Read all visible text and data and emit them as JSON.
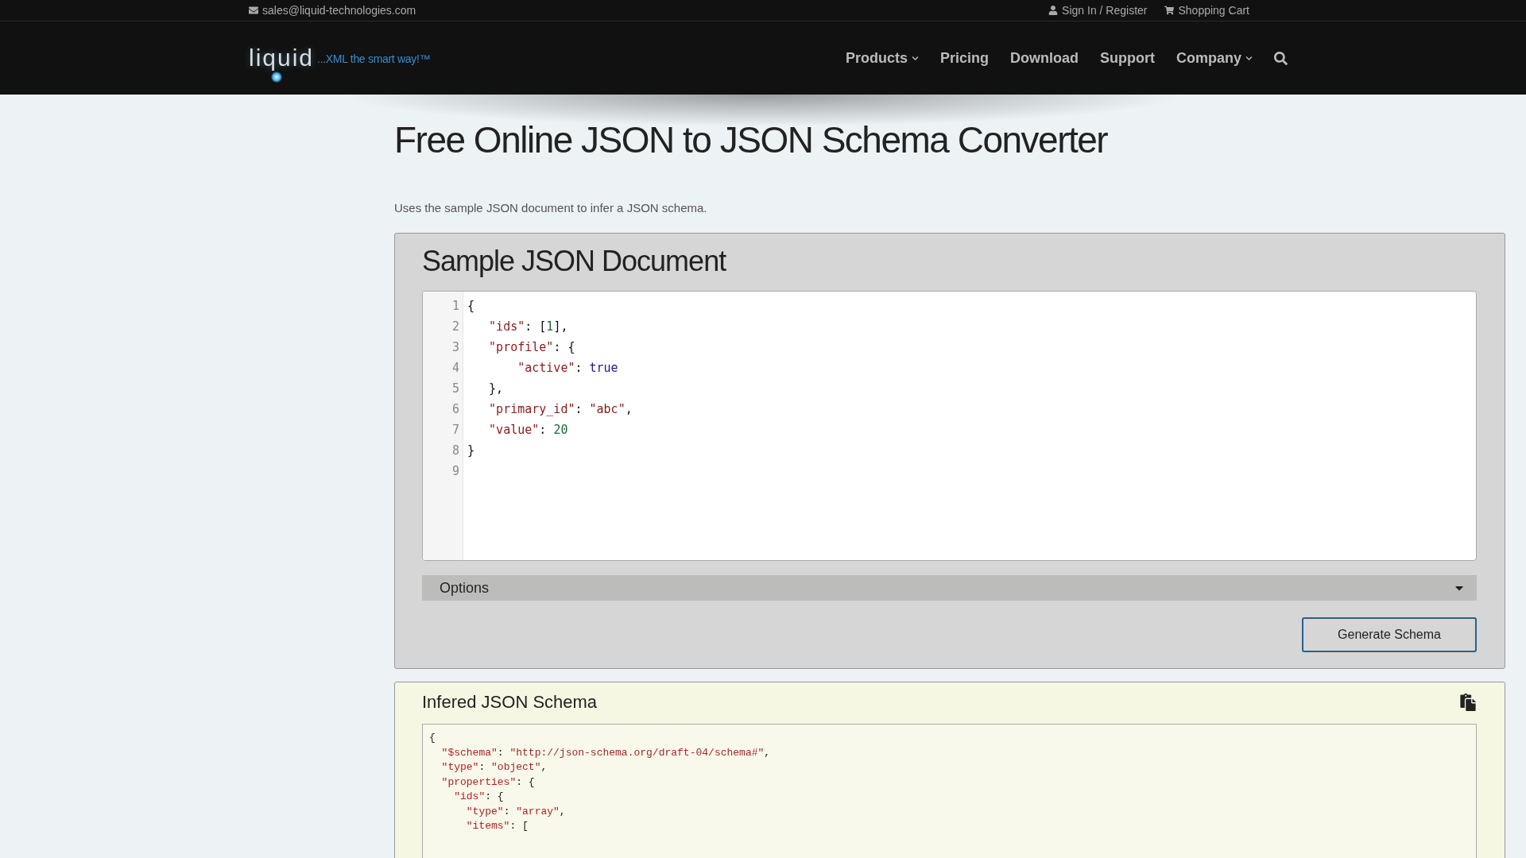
{
  "top_bar": {
    "email": "sales@liquid-technologies.com",
    "sign_in": "Sign In / Register",
    "cart": "Shopping Cart"
  },
  "logo": {
    "name": "liquid",
    "tagline": "...XML the smart way!™"
  },
  "nav": [
    {
      "label": "Products",
      "dropdown": true
    },
    {
      "label": "Pricing",
      "dropdown": false
    },
    {
      "label": "Download",
      "dropdown": false
    },
    {
      "label": "Support",
      "dropdown": false
    },
    {
      "label": "Company",
      "dropdown": true
    }
  ],
  "page": {
    "title": "Free Online JSON to JSON Schema Converter",
    "intro": "Uses the sample JSON document to infer a JSON schema."
  },
  "sample_panel": {
    "heading": "Sample JSON Document",
    "lines": [
      {
        "number": "1",
        "tokens": [
          {
            "kind": "punct",
            "text": "{"
          }
        ]
      },
      {
        "number": "2",
        "tokens": [
          {
            "kind": "key",
            "text": "   \"ids\""
          },
          {
            "kind": "punct",
            "text": ": ["
          },
          {
            "kind": "number",
            "text": "1"
          },
          {
            "kind": "punct",
            "text": "],"
          }
        ]
      },
      {
        "number": "3",
        "tokens": [
          {
            "kind": "key",
            "text": "   \"profile\""
          },
          {
            "kind": "punct",
            "text": ": {"
          }
        ]
      },
      {
        "number": "4",
        "tokens": [
          {
            "kind": "key",
            "text": "       \"active\""
          },
          {
            "kind": "punct",
            "text": ": "
          },
          {
            "kind": "bool",
            "text": "true"
          }
        ]
      },
      {
        "number": "5",
        "tokens": [
          {
            "kind": "punct",
            "text": "   },"
          }
        ]
      },
      {
        "number": "6",
        "tokens": [
          {
            "kind": "key",
            "text": "   \"primary_id\""
          },
          {
            "kind": "punct",
            "text": ": "
          },
          {
            "kind": "string",
            "text": "\"abc\""
          },
          {
            "kind": "punct",
            "text": ","
          }
        ]
      },
      {
        "number": "7",
        "tokens": [
          {
            "kind": "key",
            "text": "   \"value\""
          },
          {
            "kind": "punct",
            "text": ": "
          },
          {
            "kind": "number",
            "text": "20"
          }
        ]
      },
      {
        "number": "8",
        "tokens": [
          {
            "kind": "punct",
            "text": "}"
          }
        ]
      },
      {
        "number": "9"
      }
    ],
    "options": {
      "label": "Options",
      "expanded": false
    },
    "button": "Generate Schema"
  },
  "schema_panel": {
    "heading": "Infered JSON Schema",
    "lines": [
      {
        "tokens": [
          {
            "kind": "punct",
            "text": "{"
          }
        ]
      },
      {
        "tokens": [
          {
            "kind": "key",
            "text": "  \"$schema\""
          },
          {
            "kind": "punct",
            "text": ": "
          },
          {
            "kind": "string",
            "text": "\"http://json-schema.org/draft-04/schema#\""
          },
          {
            "kind": "punct",
            "text": ","
          }
        ]
      },
      {
        "tokens": [
          {
            "kind": "key",
            "text": "  \"type\""
          },
          {
            "kind": "punct",
            "text": ": "
          },
          {
            "kind": "string",
            "text": "\"object\""
          },
          {
            "kind": "punct",
            "text": ","
          }
        ]
      },
      {
        "tokens": [
          {
            "kind": "key",
            "text": "  \"properties\""
          },
          {
            "kind": "punct",
            "text": ": {"
          }
        ]
      },
      {
        "tokens": [
          {
            "kind": "key",
            "text": "    \"ids\""
          },
          {
            "kind": "punct",
            "text": ": {"
          }
        ]
      },
      {
        "tokens": [
          {
            "kind": "key",
            "text": "      \"type\""
          },
          {
            "kind": "punct",
            "text": ": "
          },
          {
            "kind": "string",
            "text": "\"array\""
          },
          {
            "kind": "punct",
            "text": ","
          }
        ]
      },
      {
        "tokens": [
          {
            "kind": "key",
            "text": "      \"items\""
          },
          {
            "kind": "punct",
            "text": ": ["
          }
        ]
      }
    ]
  }
}
